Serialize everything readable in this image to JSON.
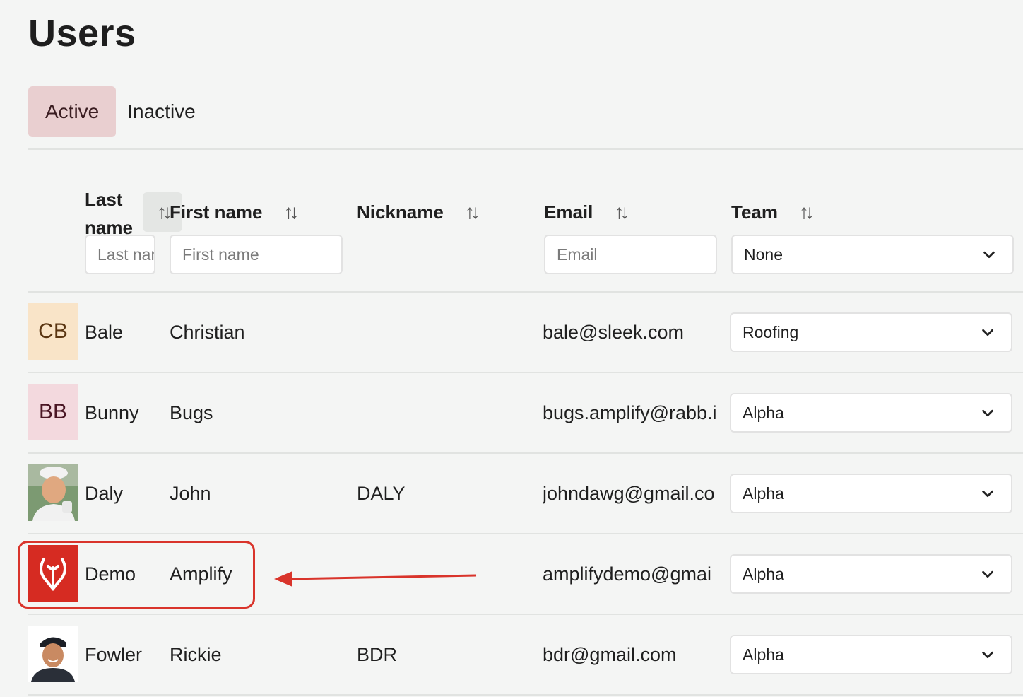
{
  "page": {
    "title": "Users"
  },
  "tabs": [
    {
      "label": "Active",
      "active": true
    },
    {
      "label": "Inactive",
      "active": false
    }
  ],
  "columns": {
    "last_name": "Last name",
    "first_name": "First name",
    "nickname": "Nickname",
    "email": "Email",
    "team": "Team"
  },
  "filters": {
    "last_name_placeholder": "Last name",
    "first_name_placeholder": "First name",
    "email_placeholder": "Email",
    "team_value": "None"
  },
  "rows": [
    {
      "initials": "CB",
      "avatar_bg": "#f9e4c8",
      "avatar_fg": "#6b3d12",
      "last": "Bale",
      "first": "Christian",
      "nickname": "",
      "email": "bale@sleek.com",
      "team": "Roofing",
      "avatar_type": "initials"
    },
    {
      "initials": "BB",
      "avatar_bg": "#f3d9de",
      "avatar_fg": "#5a1d2a",
      "last": "Bunny",
      "first": "Bugs",
      "nickname": "",
      "email": "bugs.amplify@rabb.i",
      "team": "Alpha",
      "avatar_type": "initials"
    },
    {
      "initials": "",
      "last": "Daly",
      "first": "John",
      "nickname": "DALY",
      "email": "johndawg@gmail.co",
      "team": "Alpha",
      "avatar_type": "photo-icon"
    },
    {
      "initials": "",
      "last": "Demo",
      "first": "Amplify",
      "nickname": "",
      "email": "amplifydemo@gmai",
      "team": "Alpha",
      "avatar_type": "logo-icon"
    },
    {
      "initials": "",
      "last": "Fowler",
      "first": "Rickie",
      "nickname": "BDR",
      "email": "bdr@gmail.com",
      "team": "Alpha",
      "avatar_type": "photo-icon"
    }
  ],
  "colors": {
    "accent_tab": "#e9cfd0",
    "annotation_red": "#d9342b",
    "logo_red": "#d62b22"
  }
}
